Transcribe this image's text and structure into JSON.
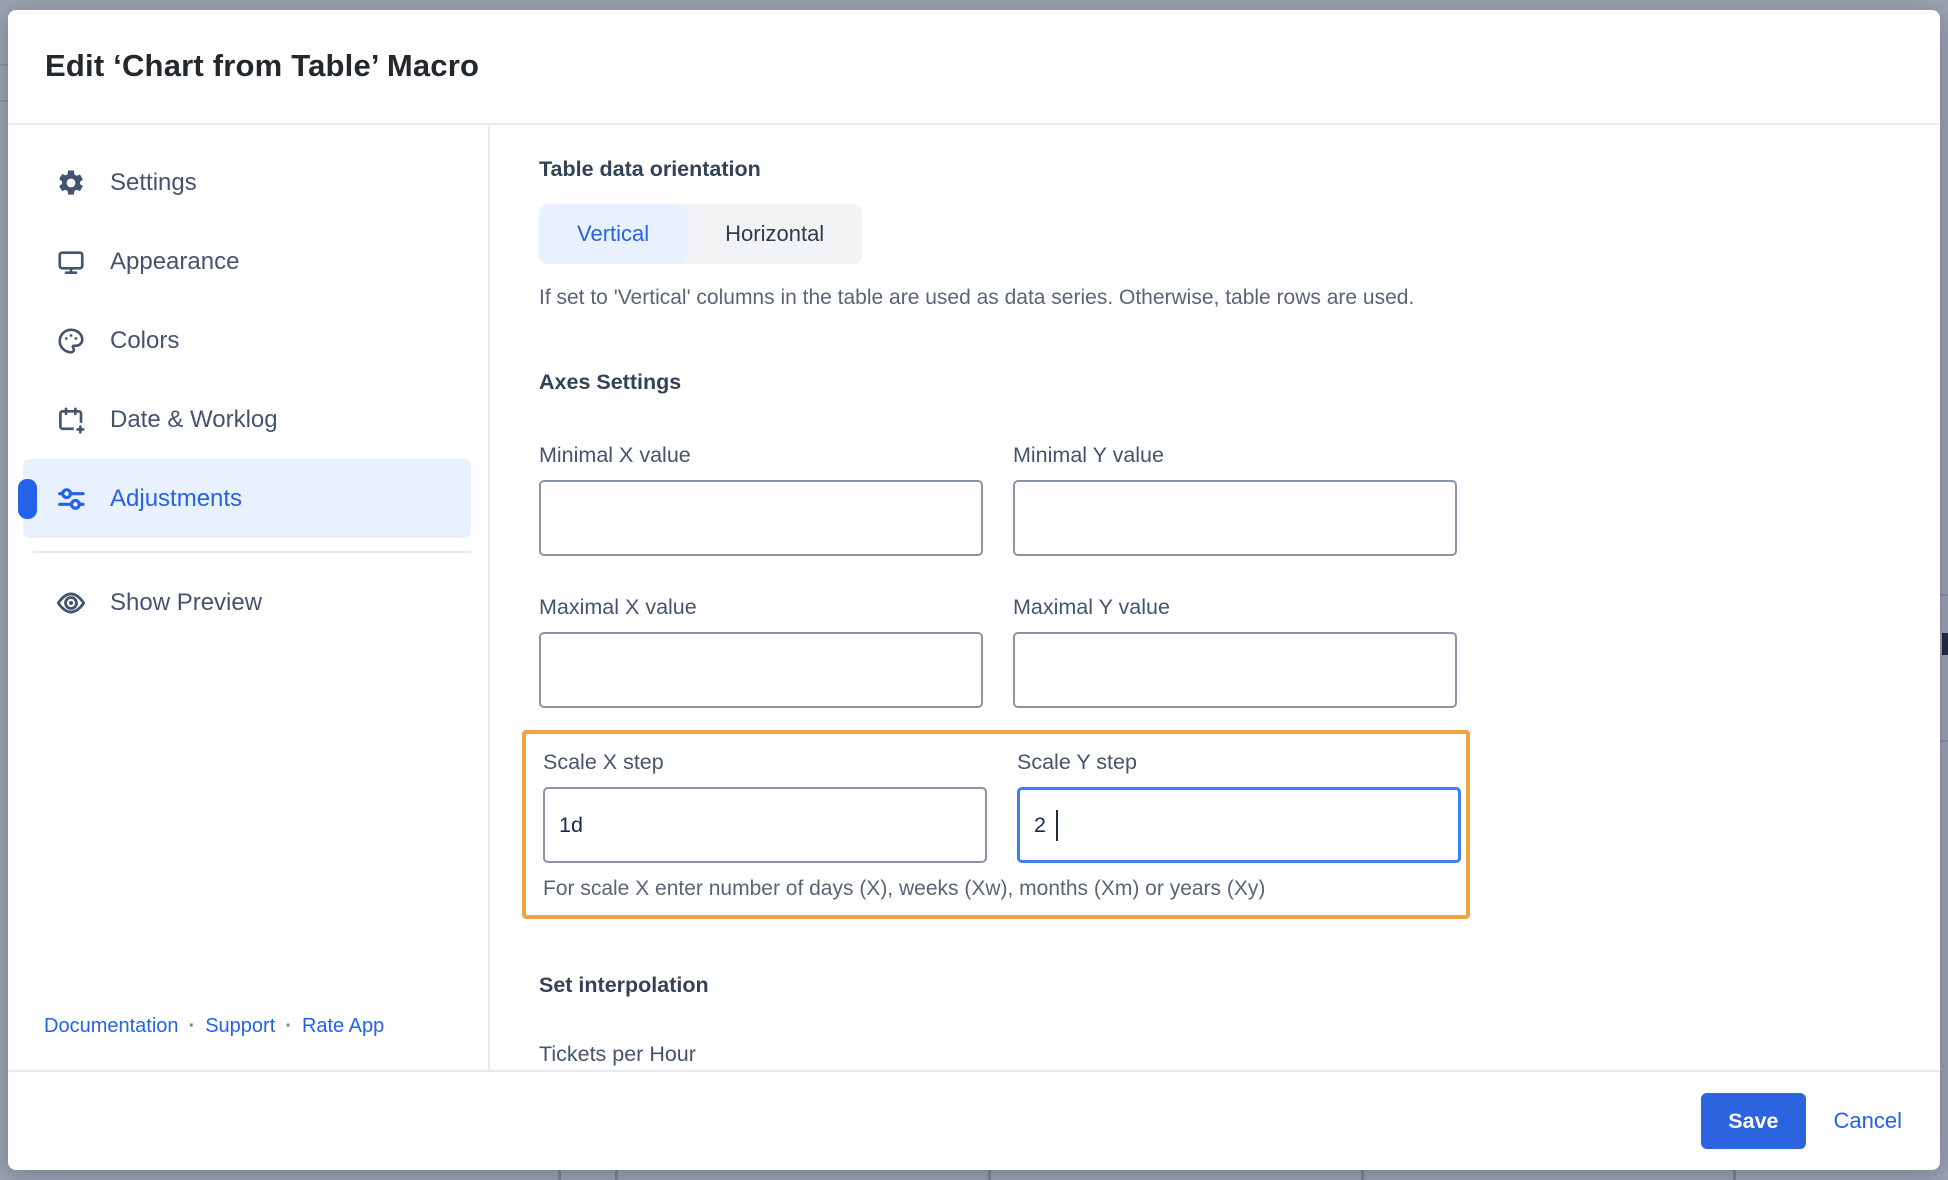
{
  "dialog": {
    "title": "Edit ‘Chart from Table’ Macro"
  },
  "sidebar": {
    "items": [
      {
        "label": "Settings",
        "icon": "gear-icon",
        "selected": false
      },
      {
        "label": "Appearance",
        "icon": "monitor-icon",
        "selected": false
      },
      {
        "label": "Colors",
        "icon": "palette-icon",
        "selected": false
      },
      {
        "label": "Date & Worklog",
        "icon": "calendar-plus-icon",
        "selected": false
      },
      {
        "label": "Adjustments",
        "icon": "sliders-icon",
        "selected": true
      },
      {
        "label": "Show Preview",
        "icon": "eye-icon",
        "selected": false
      }
    ],
    "separator": "·",
    "footer_links": [
      "Documentation",
      "Support",
      "Rate App"
    ]
  },
  "content": {
    "orientation": {
      "heading": "Table data orientation",
      "options": [
        "Vertical",
        "Horizontal"
      ],
      "selected": "Vertical",
      "help": "If set to 'Vertical' columns in the table are used as data series. Otherwise, table rows are used."
    },
    "axes": {
      "heading": "Axes Settings",
      "fields": [
        {
          "label": "Minimal X value",
          "value": ""
        },
        {
          "label": "Minimal Y value",
          "value": ""
        },
        {
          "label": "Maximal X value",
          "value": ""
        },
        {
          "label": "Maximal Y value",
          "value": ""
        }
      ],
      "scale": {
        "x_label": "Scale X step",
        "x_value": "1d",
        "y_label": "Scale Y step",
        "y_value": "2",
        "help": "For scale X enter number of days (X), weeks (Xw), months (Xm) or years (Xy)"
      }
    },
    "interpolation": {
      "heading": "Set interpolation",
      "field_label": "Tickets per Hour",
      "field_value": ""
    }
  },
  "footer": {
    "save_label": "Save",
    "cancel_label": "Cancel"
  },
  "colors": {
    "accent_blue": "#2462E9",
    "save_button_blue": "#2C63DE",
    "focus_border_blue": "#3D7DF5",
    "selected_item_bg": "#EAF1FE",
    "highlight_orange": "#F2A33C",
    "backdrop_gray": "#9BA2B0",
    "sidebar_text": "#44546F"
  }
}
